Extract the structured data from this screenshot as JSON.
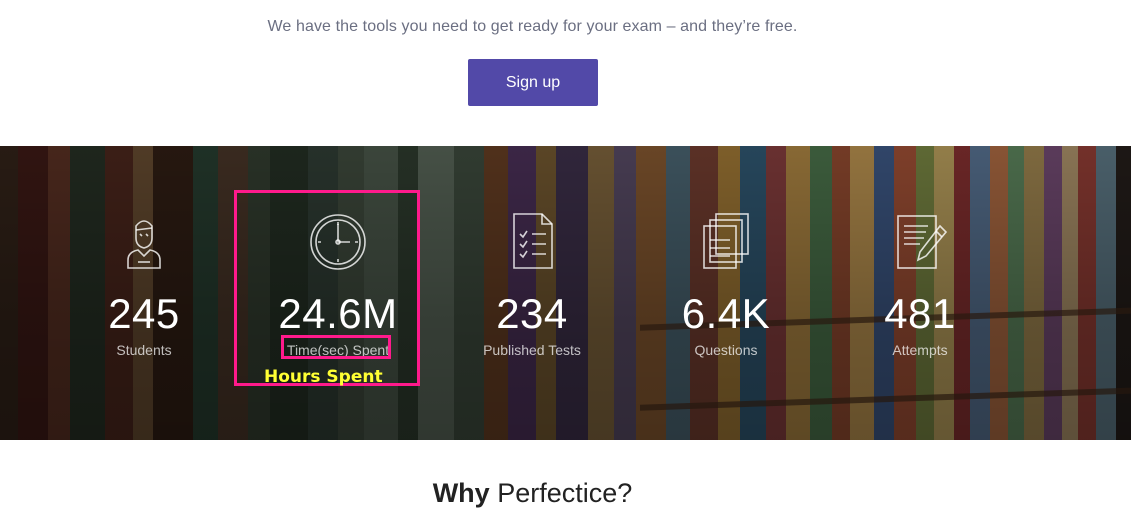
{
  "hero": {
    "tagline": "We have the tools you need to get ready for your exam – and they’re free.",
    "signup_label": "Sign up"
  },
  "stats": [
    {
      "icon": "student-icon",
      "value": "245",
      "label": "Students"
    },
    {
      "icon": "clock-icon",
      "value": "24.6M",
      "label": "Time(sec) Spent"
    },
    {
      "icon": "document-checklist-icon",
      "value": "234",
      "label": "Published Tests"
    },
    {
      "icon": "stacked-documents-icon",
      "value": "6.4K",
      "label": "Questions"
    },
    {
      "icon": "document-pencil-icon",
      "value": "481",
      "label": "Attempts"
    }
  ],
  "annotation": {
    "text": "Hours Spent",
    "color": "#ffff33",
    "highlight_color": "#ff1a8c"
  },
  "why": {
    "bold": "Why",
    "rest": " Perfectice?"
  },
  "colors": {
    "accent": "#5249a8",
    "tagline": "#6b6f82"
  }
}
